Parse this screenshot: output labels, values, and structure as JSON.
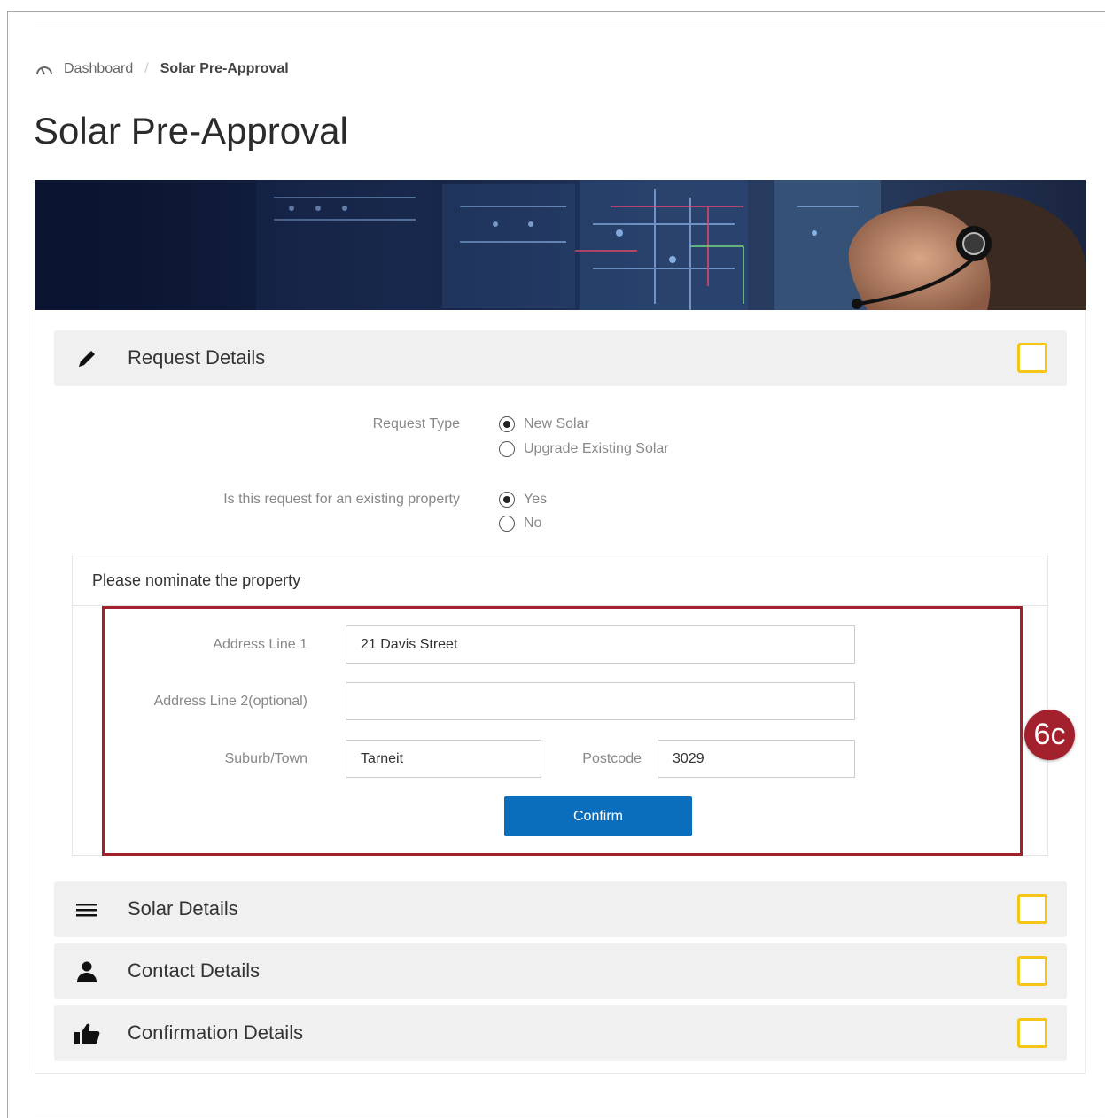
{
  "breadcrumb": {
    "home_icon": "dashboard-gauge-icon",
    "home_label": "Dashboard",
    "separator": "/",
    "current": "Solar Pre-Approval"
  },
  "page": {
    "title": "Solar Pre-Approval"
  },
  "banner": {
    "description_icon": "control-room-headset-operator-image"
  },
  "sections": {
    "request": {
      "title": "Request Details",
      "icon": "pencil-icon",
      "completed": false
    },
    "solar": {
      "title": "Solar Details",
      "icon": "menu-lines-icon",
      "completed": false
    },
    "contact": {
      "title": "Contact Details",
      "icon": "person-icon",
      "completed": false
    },
    "confirmation": {
      "title": "Confirmation Details",
      "icon": "thumbs-up-icon",
      "completed": false
    }
  },
  "request_form": {
    "request_type": {
      "label": "Request Type",
      "options": [
        "New Solar",
        "Upgrade Existing Solar"
      ],
      "selected": "New Solar"
    },
    "existing_property": {
      "label": "Is this request for an existing property",
      "options": [
        "Yes",
        "No"
      ],
      "selected": "Yes"
    }
  },
  "property": {
    "heading": "Please nominate the property",
    "address_line1": {
      "label": "Address Line 1",
      "value": "21 Davis Street"
    },
    "address_line2": {
      "label": "Address Line 2(optional)",
      "value": ""
    },
    "suburb": {
      "label": "Suburb/Town",
      "value": "Tarneit"
    },
    "postcode": {
      "label": "Postcode",
      "value": "3029"
    },
    "confirm_label": "Confirm"
  },
  "annotation": {
    "step_label": "6c"
  },
  "colors": {
    "accent_blue": "#0a6ebd",
    "annotation_red": "#a3202d",
    "checkbox_yellow": "#f5c518",
    "section_bg": "#f0f0f0"
  }
}
